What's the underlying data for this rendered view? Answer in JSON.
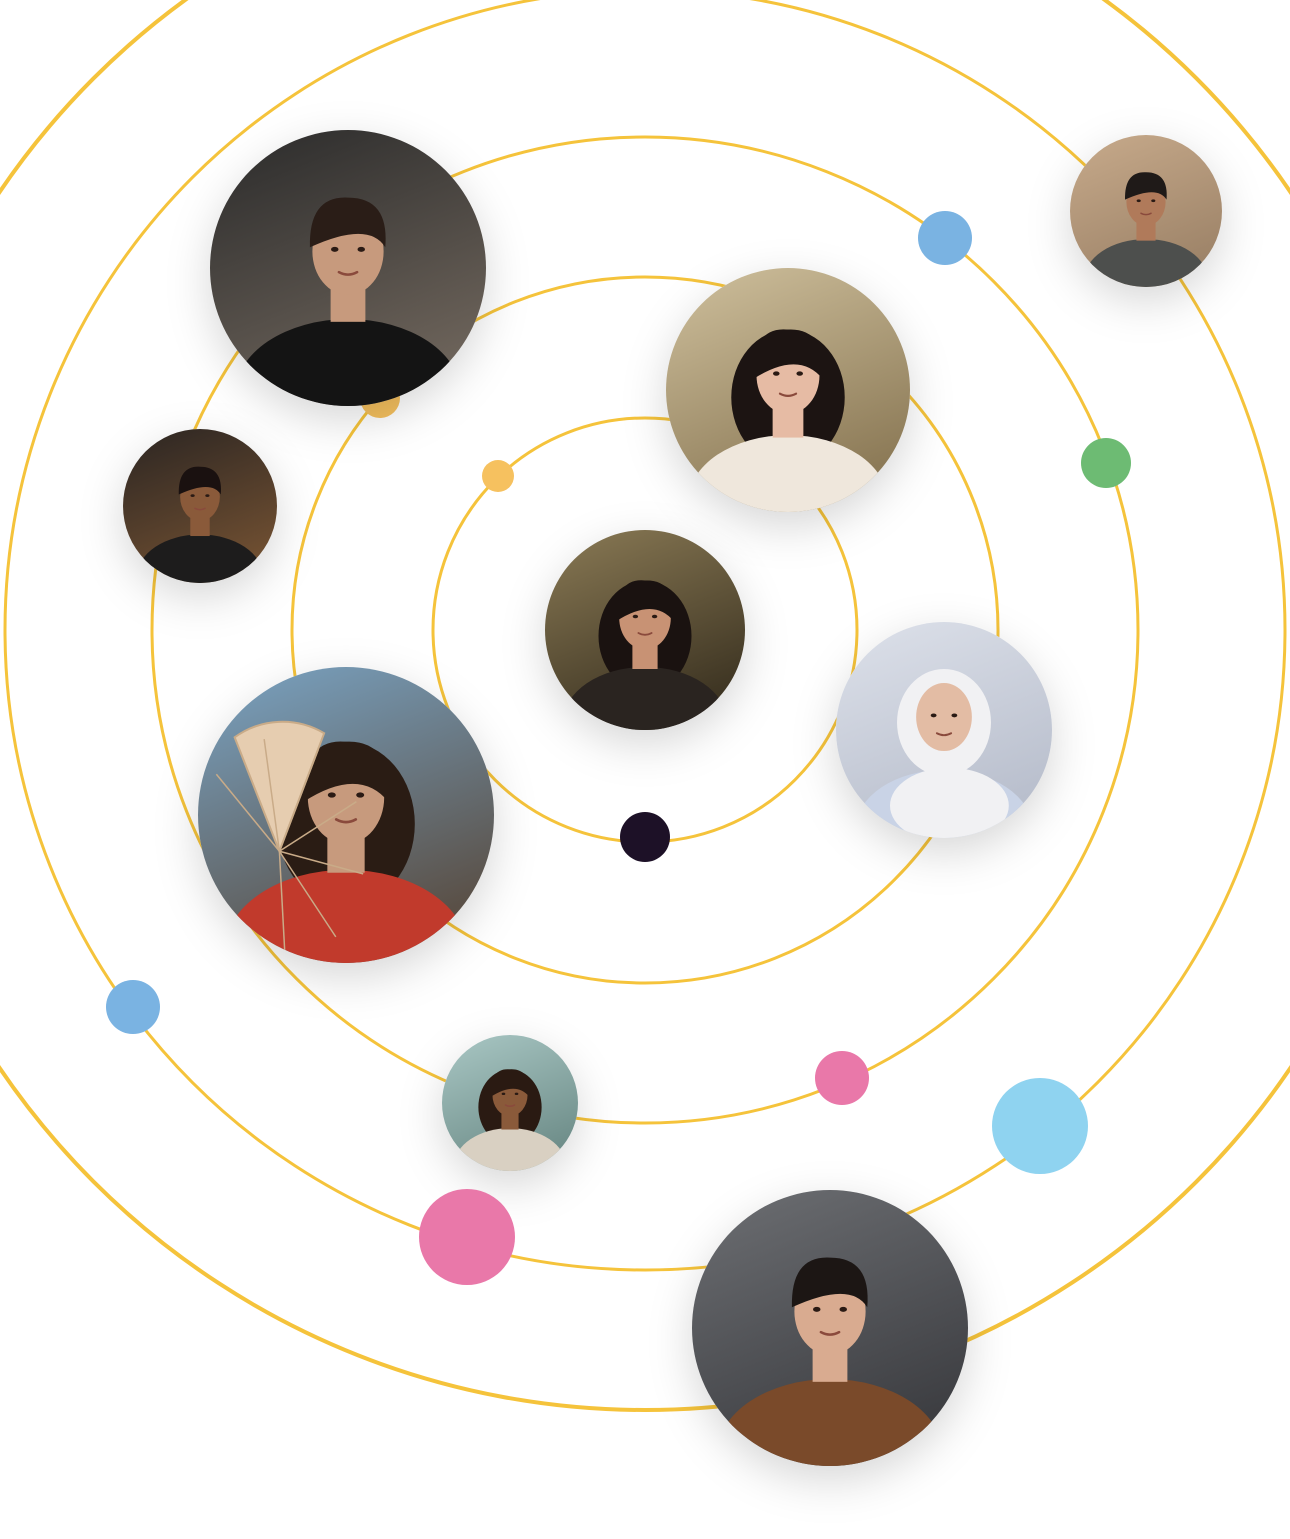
{
  "colors": {
    "background": "#ffffff",
    "orbit": "#f5c33b",
    "dot_yellow": "#f6c15f",
    "dot_blue": "#7ab3e2",
    "dot_sky": "#8fd3f0",
    "dot_green": "#6dbb73",
    "dot_pink": "#e978a9",
    "dot_dark": "#1d1127"
  },
  "orbits": [
    "orbit-1",
    "orbit-2",
    "orbit-3",
    "orbit-4",
    "orbit-5"
  ],
  "avatars": [
    {
      "name": "avatar-man-dark-shirt",
      "kind": "man",
      "bg": [
        "#2a2a2a",
        "#6b6259"
      ],
      "skin": "#c79a7d",
      "hair": "#2a1d17",
      "shirt": "#141414"
    },
    {
      "name": "avatar-man-beard-top-right",
      "kind": "man",
      "bg": [
        "#c7aa8b",
        "#9e8469"
      ],
      "skin": "#b07a5a",
      "hair": "#1f1a18",
      "shirt": "#4d4f4d"
    },
    {
      "name": "avatar-woman-dark-hair",
      "kind": "woman",
      "bg": [
        "#cfc09d",
        "#8c7a57"
      ],
      "skin": "#e6bba4",
      "hair": "#1c1412",
      "shirt": "#efe7dc"
    },
    {
      "name": "avatar-man-dreadlocks",
      "kind": "man",
      "bg": [
        "#2b2522",
        "#6e4e31"
      ],
      "skin": "#8a5a3a",
      "hair": "#1a1110",
      "shirt": "#1d1c1c"
    },
    {
      "name": "avatar-woman-center",
      "kind": "woman",
      "bg": [
        "#8a7a55",
        "#3e3523"
      ],
      "skin": "#c89274",
      "hair": "#1a1210",
      "shirt": "#2a2420"
    },
    {
      "name": "avatar-woman-headscarf",
      "kind": "scarf",
      "bg": [
        "#dde1ea",
        "#b9bfcd"
      ],
      "skin": "#e3bca4",
      "hair": "#f1f1f3",
      "shirt": "#c9d3e6"
    },
    {
      "name": "avatar-woman-fan",
      "kind": "fan",
      "bg": [
        "#7aa4c4",
        "#5a5047"
      ],
      "skin": "#c79a7d",
      "hair": "#2a1c14",
      "shirt": "#c13a2c"
    },
    {
      "name": "avatar-woman-smiling",
      "kind": "woman",
      "bg": [
        "#a9c7c4",
        "#6f8e8a"
      ],
      "skin": "#8a5a3a",
      "hair": "#2a1a12",
      "shirt": "#d9d0c2"
    },
    {
      "name": "avatar-man-jacket",
      "kind": "man",
      "bg": [
        "#6d6f73",
        "#3d3e42"
      ],
      "skin": "#d9ab90",
      "hair": "#1c1614",
      "shirt": "#7a4a2a"
    }
  ],
  "dots": [
    {
      "name": "dot-yellow-inner",
      "color": "dot_yellow"
    },
    {
      "name": "dot-yellow-under-avatar",
      "color": "dot_yellow"
    },
    {
      "name": "dot-blue-top",
      "color": "dot_blue"
    },
    {
      "name": "dot-green-right",
      "color": "dot_green"
    },
    {
      "name": "dot-dark-center",
      "color": "dot_dark"
    },
    {
      "name": "dot-blue-left",
      "color": "dot_blue"
    },
    {
      "name": "dot-pink-small",
      "color": "dot_pink"
    },
    {
      "name": "dot-sky-large",
      "color": "dot_sky"
    },
    {
      "name": "dot-pink-large",
      "color": "dot_pink"
    }
  ]
}
